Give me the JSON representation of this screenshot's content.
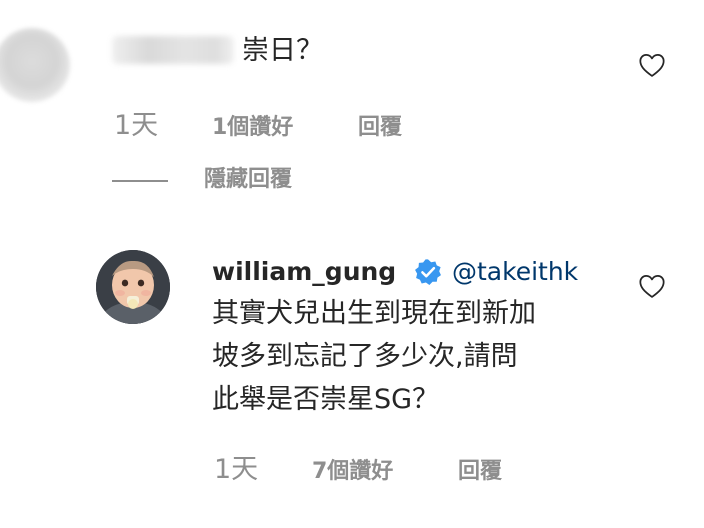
{
  "comment1": {
    "text": "崇日？",
    "time": "1天",
    "likes": "1個讚好",
    "reply": "回覆",
    "hide_replies": "隱藏回覆"
  },
  "reply1": {
    "username": "william_gung",
    "mention": "@takeithk",
    "lines": [
      "其實犬兒出生到現在到新加",
      "坡多到忘記了多少次,請問",
      "此舉是否崇星SG？"
    ],
    "time": "1天",
    "likes": "7個讚好",
    "reply": "回覆"
  },
  "icons": {
    "like": "heart-outline-icon",
    "verified": "verified-badge-icon",
    "verified_color": "#3897f0"
  }
}
